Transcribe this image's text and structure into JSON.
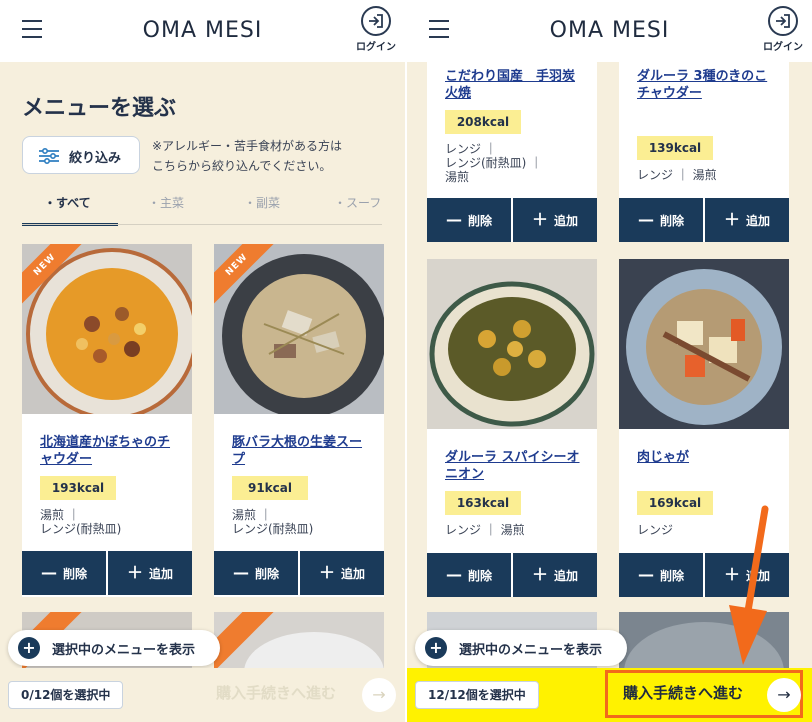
{
  "app": {
    "logo": "OMA MESI",
    "login_label": "ログイン"
  },
  "left": {
    "page_title": "メニューを選ぶ",
    "filter_label": "絞り込み",
    "filter_note": "※アレルギー・苦手食材がある方は\nこちらから絞り込んでください。",
    "tabs": [
      "・すべて",
      "・主菜",
      "・副菜",
      "・スーフ"
    ],
    "cards": [
      {
        "badge": "NEW",
        "name": "北海道産かぼちゃのチャウダー",
        "kcal": "193kcal",
        "method": "湯煎 ｜\nレンジ(耐熱皿)",
        "delete": "削除",
        "add": "追加"
      },
      {
        "badge": "NEW",
        "name": "豚バラ大根の生姜スープ",
        "kcal": "91kcal",
        "method": "湯煎 ｜\nレンジ(耐熱皿)",
        "delete": "削除",
        "add": "追加"
      }
    ],
    "show_selected": "選択中のメニューを表示",
    "count": "0/12個を選択中",
    "proceed": "購入手続きへ進む"
  },
  "right": {
    "cards": [
      {
        "name": "こだわり国産　手羽炭火焼",
        "kcal": "208kcal",
        "method": "レンジ ｜\nレンジ(耐熱皿) ｜\n湯煎",
        "delete": "削除",
        "add": "追加"
      },
      {
        "name": "ダルーラ 3種のきのこチャウダー",
        "kcal": "139kcal",
        "method": "レンジ ｜ 湯煎",
        "delete": "削除",
        "add": "追加"
      },
      {
        "name": "ダルーラ スパイシーオニオン",
        "kcal": "163kcal",
        "method": "レンジ ｜ 湯煎",
        "delete": "削除",
        "add": "追加"
      },
      {
        "name": "肉じゃが",
        "kcal": "169kcal",
        "method": "レンジ",
        "delete": "削除",
        "add": "追加"
      }
    ],
    "show_selected": "選択中のメニューを表示",
    "count": "12/12個を選択中",
    "proceed": "購入手続きへ進む"
  },
  "colors": {
    "navy": "#1a3a5a",
    "kcal_badge": "#fbee93",
    "new_ribbon": "#ef7c2f",
    "footer_inactive": "#f6efdd",
    "footer_active": "#fff200",
    "highlight": "#f26a1b"
  }
}
